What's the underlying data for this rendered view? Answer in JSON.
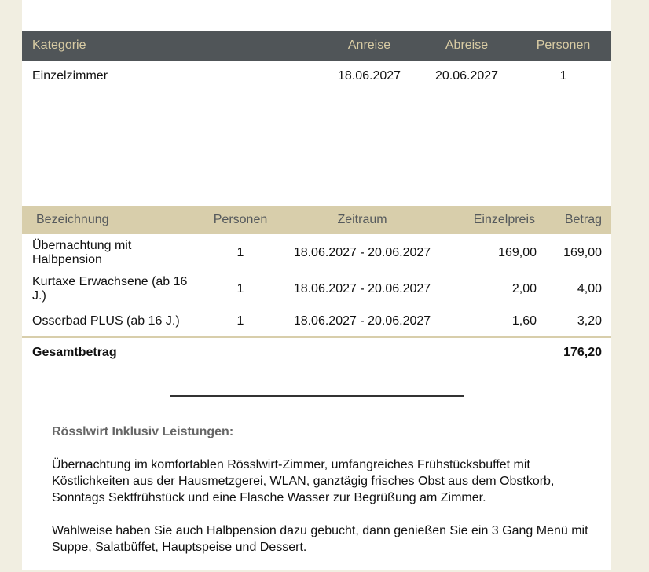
{
  "booking": {
    "headers": [
      "Kategorie",
      "Anreise",
      "Abreise",
      "Personen"
    ],
    "rows": [
      {
        "kategorie": "Einzelzimmer",
        "anreise": "18.06.2027",
        "abreise": "20.06.2027",
        "personen": "1"
      }
    ]
  },
  "items": {
    "headers": [
      "Bezeichnung",
      "Personen",
      "Zeitraum",
      "Einzelpreis",
      "Betrag"
    ],
    "rows": [
      {
        "bezeichnung": "Übernachtung mit Halbpension",
        "personen": "1",
        "zeitraum": "18.06.2027 - 20.06.2027",
        "einzelpreis": "169,00",
        "betrag": "169,00"
      },
      {
        "bezeichnung": "Kurtaxe Erwachsene (ab 16 J.)",
        "personen": "1",
        "zeitraum": "18.06.2027 - 20.06.2027",
        "einzelpreis": "2,00",
        "betrag": "4,00"
      },
      {
        "bezeichnung": "Osserbad PLUS (ab 16 J.)",
        "personen": "1",
        "zeitraum": "18.06.2027 - 20.06.2027",
        "einzelpreis": "1,60",
        "betrag": "3,20"
      }
    ],
    "total_label": "Gesamtbetrag",
    "total_value": "176,20"
  },
  "inclusive": {
    "title": "Rösslwirt Inklusiv Leistungen:",
    "paragraphs": [
      "Übernachtung im komfortablen Rösslwirt-Zimmer, umfangreiches Frühstücksbuffet mit Köstlichkeiten aus der Hausmetzgerei, WLAN, ganztägig frisches Obst aus dem Obstkorb, Sonntags Sektfrühstück und eine Flasche Wasser zur Begrüßung am Zimmer.",
      "Wahlweise haben Sie auch Halbpension dazu gebucht, dann genießen Sie ein 3 Gang Menü mit Suppe, Salatbüffet, Hauptspeise und Dessert."
    ]
  },
  "colors": {
    "page_background": "#f1eee1",
    "booking_header_bg": "#505558",
    "booking_header_text": "#d9cca4",
    "items_header_bg": "#d8ceab",
    "items_header_text": "#55595c"
  }
}
